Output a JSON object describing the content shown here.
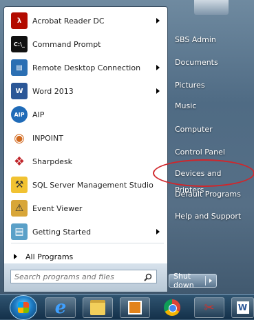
{
  "pinned_programs": [
    {
      "label": "Acrobat Reader DC",
      "icon": "acrobat-icon",
      "has_submenu": true
    },
    {
      "label": "Command Prompt",
      "icon": "command-prompt-icon",
      "has_submenu": false
    },
    {
      "label": "Remote Desktop Connection",
      "icon": "remote-desktop-icon",
      "has_submenu": true
    },
    {
      "label": "Word 2013",
      "icon": "word-icon",
      "has_submenu": true
    },
    {
      "label": "AIP",
      "icon": "aip-icon",
      "has_submenu": false
    },
    {
      "label": "INPOINT",
      "icon": "inpoint-icon",
      "has_submenu": false
    },
    {
      "label": "Sharpdesk",
      "icon": "sharpdesk-icon",
      "has_submenu": false
    },
    {
      "label": "SQL Server Management Studio",
      "icon": "sql-server-icon",
      "has_submenu": false
    },
    {
      "label": "Event Viewer",
      "icon": "event-viewer-icon",
      "has_submenu": false
    },
    {
      "label": "Getting Started",
      "icon": "getting-started-icon",
      "has_submenu": true
    }
  ],
  "all_programs_label": "All Programs",
  "search": {
    "placeholder": "Search programs and files"
  },
  "right_items": [
    {
      "label": "SBS Admin"
    },
    {
      "label": "Documents"
    },
    {
      "label": "Pictures"
    },
    {
      "label": "Music"
    },
    {
      "label": "Computer"
    },
    {
      "label": "Control Panel"
    },
    {
      "label": "Devices and Printers"
    },
    {
      "label": "Default Programs"
    },
    {
      "label": "Help and Support"
    }
  ],
  "shutdown_label": "Shut down",
  "taskbar": [
    {
      "icon": "internet-explorer-icon",
      "text": "e"
    },
    {
      "icon": "file-explorer-icon",
      "text": ""
    },
    {
      "icon": "outlook-icon",
      "text": ""
    },
    {
      "icon": "chrome-icon",
      "text": ""
    },
    {
      "icon": "snipping-tool-icon",
      "text": ""
    },
    {
      "icon": "word-taskbar-icon",
      "text": "W"
    }
  ]
}
